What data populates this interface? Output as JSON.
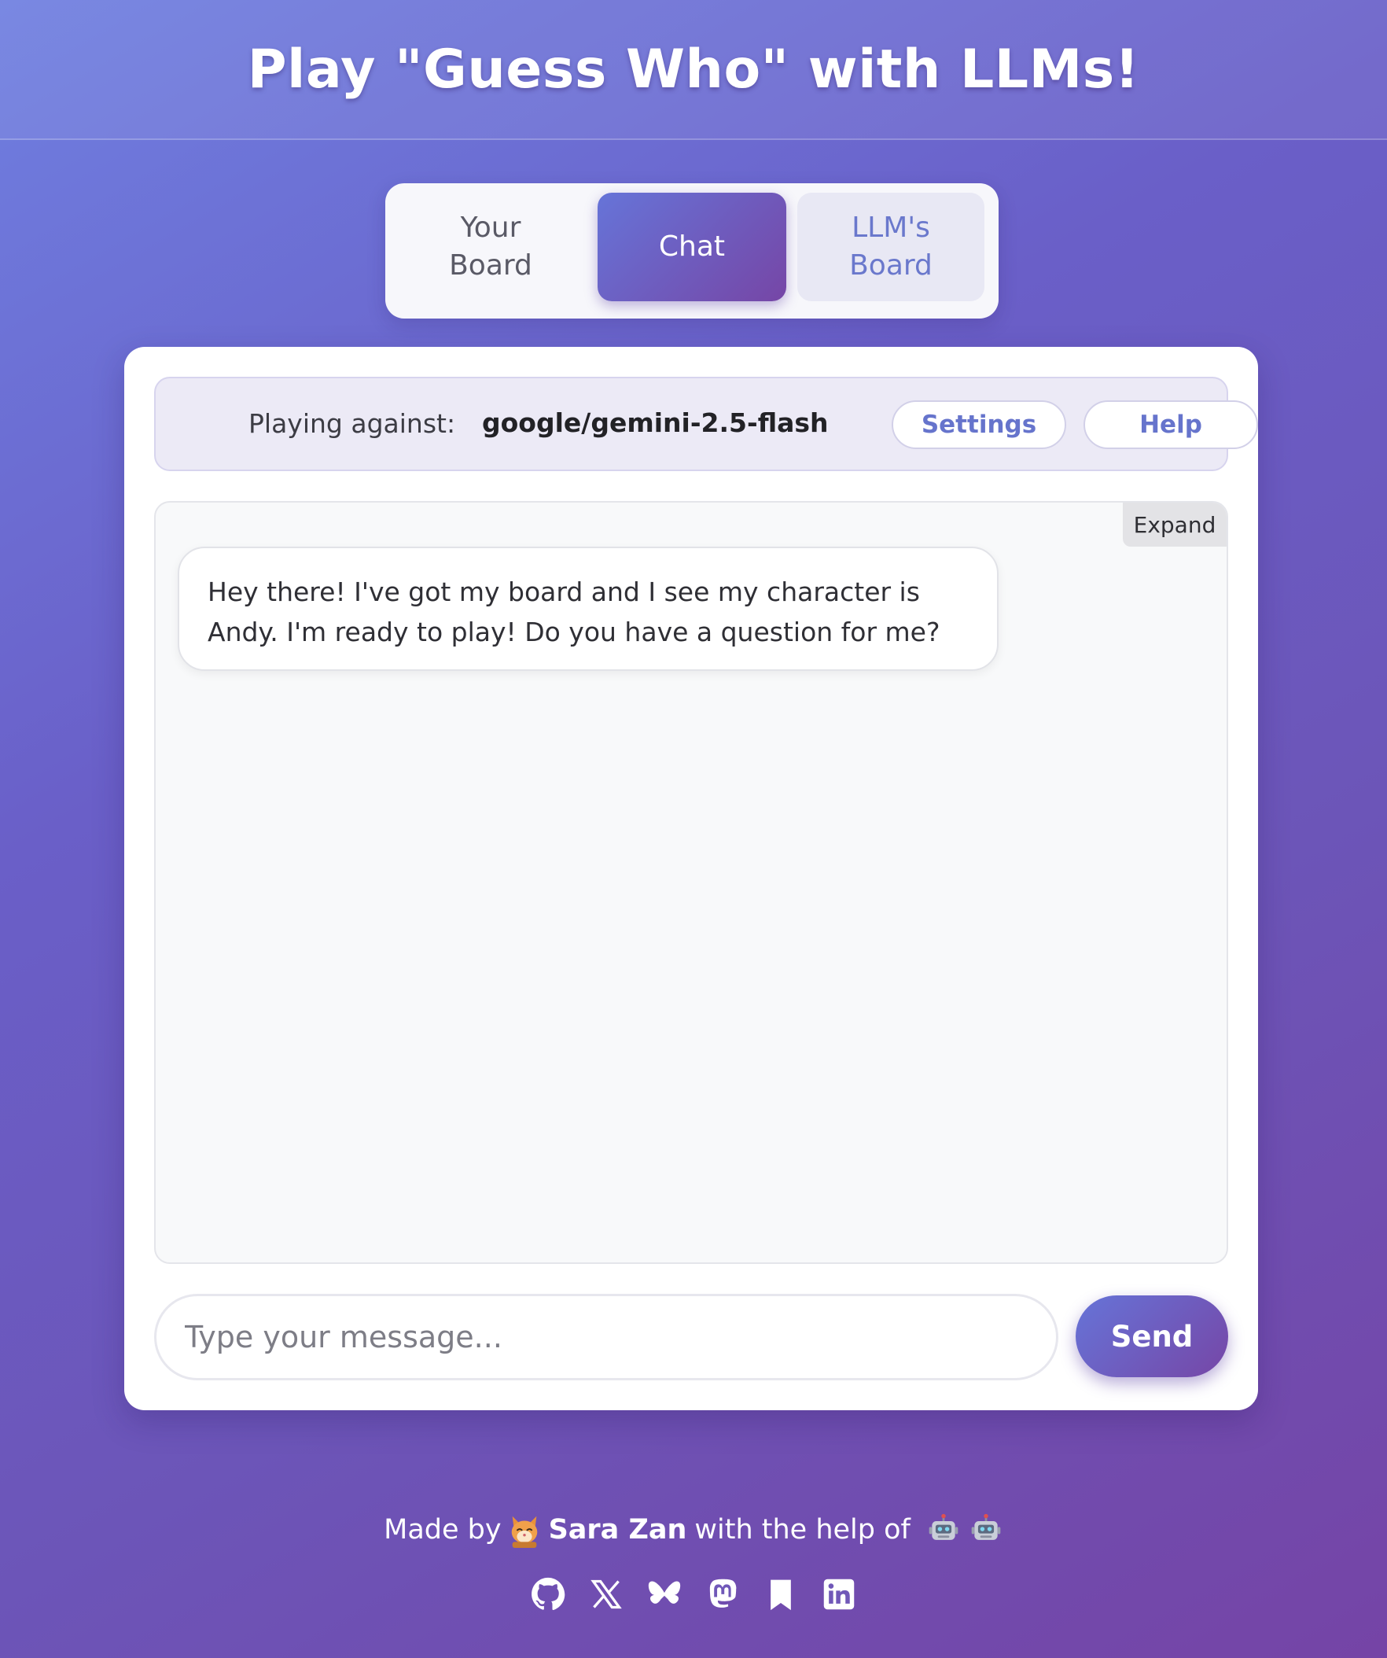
{
  "header": {
    "title": "Play \"Guess Who\" with LLMs!"
  },
  "tabs": [
    {
      "label": "Your Board",
      "active": false
    },
    {
      "label": "Chat",
      "active": true
    },
    {
      "label": "LLM's Board",
      "active": false
    }
  ],
  "infobar": {
    "playing_label": "Playing against:",
    "model": "google/gemini-2.5-flash",
    "settings_label": "Settings",
    "help_label": "Help"
  },
  "chat": {
    "expand_label": "Expand",
    "messages": [
      {
        "role": "assistant",
        "text": "Hey there! I've got my board and I see my character is Andy. I'm ready to play! Do you have a question for me?"
      }
    ]
  },
  "composer": {
    "placeholder": "Type your message...",
    "send_label": "Send"
  },
  "footer": {
    "made_by": "Made by",
    "author": "Sara Zan",
    "help_text": "with the help of",
    "icons": [
      "cat-icon",
      "robot-icon",
      "robot-icon"
    ],
    "socials": [
      "github-icon",
      "x-icon",
      "bluesky-icon",
      "mastodon-icon",
      "bookmark-icon",
      "linkedin-icon"
    ]
  },
  "colors": {
    "accent_start": "#6674d8",
    "accent_end": "#7646a6",
    "link": "#6674cc"
  }
}
